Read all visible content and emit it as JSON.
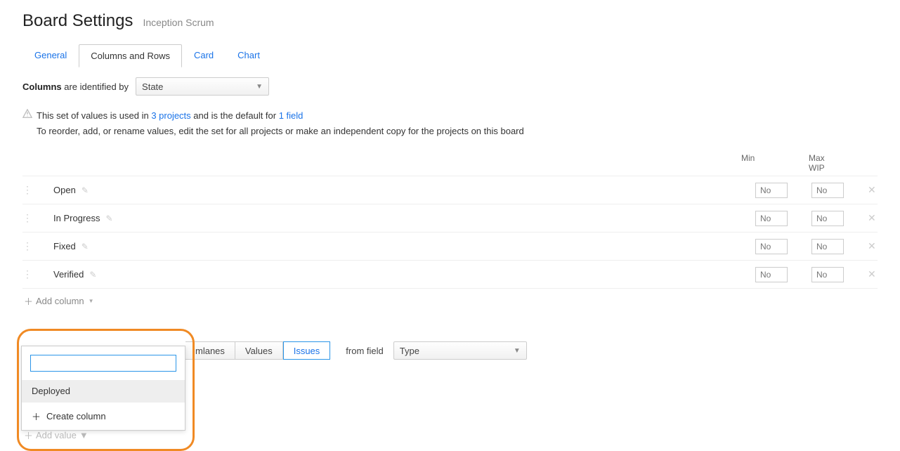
{
  "header": {
    "title": "Board Settings",
    "subtitle": "Inception Scrum"
  },
  "tabs": [
    {
      "label": "General",
      "active": false
    },
    {
      "label": "Columns and Rows",
      "active": true
    },
    {
      "label": "Card",
      "active": false
    },
    {
      "label": "Chart",
      "active": false
    }
  ],
  "identified": {
    "prefix": "Columns",
    "suffix": " are identified by",
    "select_value": "State"
  },
  "info": {
    "part1": "This set of values is used in ",
    "link_projects": "3 projects",
    "part2": " and is the default for ",
    "link_fields": "1 field",
    "line2": "To reorder, add, or rename values, edit the set for all projects or make an independent copy for the projects on this board"
  },
  "table": {
    "head_min": "Min",
    "head_max": "Max WIP",
    "placeholder": "No",
    "rows": [
      {
        "name": "Open"
      },
      {
        "name": "In Progress"
      },
      {
        "name": "Fixed"
      },
      {
        "name": "Verified"
      }
    ]
  },
  "add_column_label": "Add column",
  "add_value_label": "Add value",
  "popup": {
    "search_value": "",
    "item": "Deployed",
    "create_label": "Create column"
  },
  "bottom": {
    "seg_partial": "mlanes",
    "seg_values": "Values",
    "seg_issues": "Issues",
    "from_label": "from field",
    "type_select": "Type"
  }
}
